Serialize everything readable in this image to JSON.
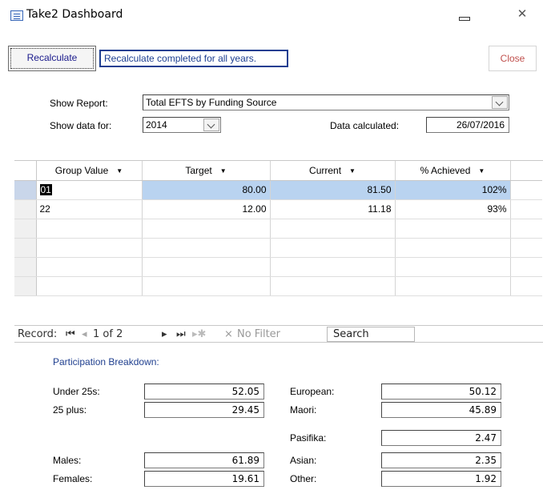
{
  "window": {
    "title": "Take2 Dashboard",
    "close_glyph": "✕"
  },
  "toolbar": {
    "recalculate_label": "Recalculate",
    "status_text": "Recalculate completed for all years.",
    "close_label": "Close"
  },
  "filters": {
    "show_report_label": "Show Report:",
    "show_report_value": "Total EFTS by Funding Source",
    "show_data_for_label": "Show data for:",
    "show_data_for_value": "2014",
    "data_calculated_label": "Data calculated:",
    "data_calculated_value": "26/07/2016"
  },
  "table": {
    "columns": [
      "Group Value",
      "Target",
      "Current",
      "% Achieved"
    ],
    "rows": [
      {
        "group": "01",
        "target": "80.00",
        "current": "81.50",
        "achieved": "102%"
      },
      {
        "group": "22",
        "target": "12.00",
        "current": "11.18",
        "achieved": "93%"
      }
    ]
  },
  "navigation": {
    "record_label": "Record:",
    "position": "1 of 2",
    "filter_label": "No Filter",
    "search_placeholder": "Search"
  },
  "participation": {
    "heading": "Participation Breakdown:",
    "left": [
      {
        "label": "Under 25s:",
        "value": "52.05"
      },
      {
        "label": "25 plus:",
        "value": "29.45"
      },
      {
        "label": "Males:",
        "value": "61.89"
      },
      {
        "label": "Females:",
        "value": "19.61"
      }
    ],
    "right": [
      {
        "label": "European:",
        "value": "50.12"
      },
      {
        "label": "Maori:",
        "value": "45.89"
      },
      {
        "label": "Pasifika:",
        "value": "2.47"
      },
      {
        "label": "Asian:",
        "value": "2.35"
      },
      {
        "label": "Other:",
        "value": "1.92"
      }
    ]
  },
  "colors": {
    "status_border": "#1c3e91",
    "close_text": "#c0504d",
    "selection_highlight": "#b9d3f0",
    "heading_blue": "#1f3f8f"
  }
}
